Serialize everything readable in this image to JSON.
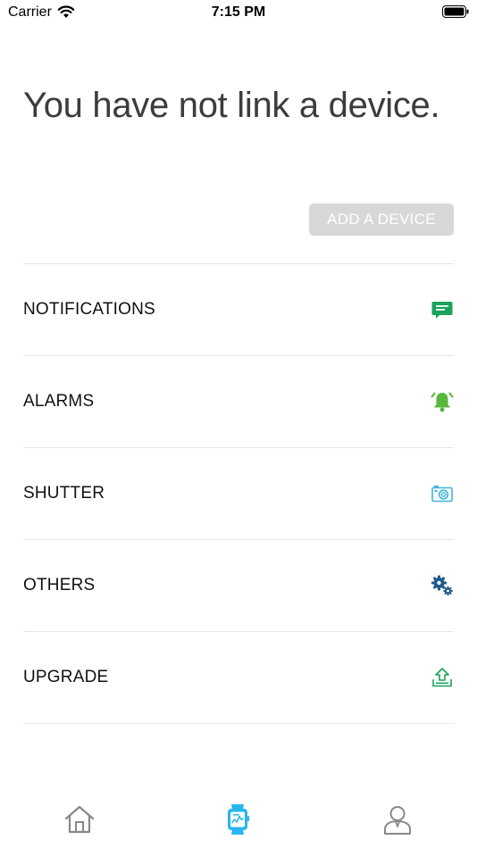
{
  "status_bar": {
    "carrier": "Carrier",
    "time": "7:15 PM"
  },
  "headline": "You have not link a device.",
  "add_device_label": "ADD A DEVICE",
  "menu": [
    {
      "label": "NOTIFICATIONS",
      "icon": "message-icon",
      "color": "#1aa35a"
    },
    {
      "label": "ALARMS",
      "icon": "alarm-bell-icon",
      "color": "#57b73c"
    },
    {
      "label": "SHUTTER",
      "icon": "camera-icon",
      "color": "#3fb3e0"
    },
    {
      "label": "OTHERS",
      "icon": "gears-icon",
      "color": "#1f5b8e"
    },
    {
      "label": "UPGRADE",
      "icon": "upload-icon",
      "color": "#1aa35a"
    }
  ],
  "tabs": [
    {
      "icon": "home-icon",
      "active": false
    },
    {
      "icon": "watch-icon",
      "active": true
    },
    {
      "icon": "profile-icon",
      "active": false
    }
  ],
  "colors": {
    "accent": "#29b6f0",
    "inactive_tab": "#888888",
    "button_disabled": "#d8d8d8"
  }
}
